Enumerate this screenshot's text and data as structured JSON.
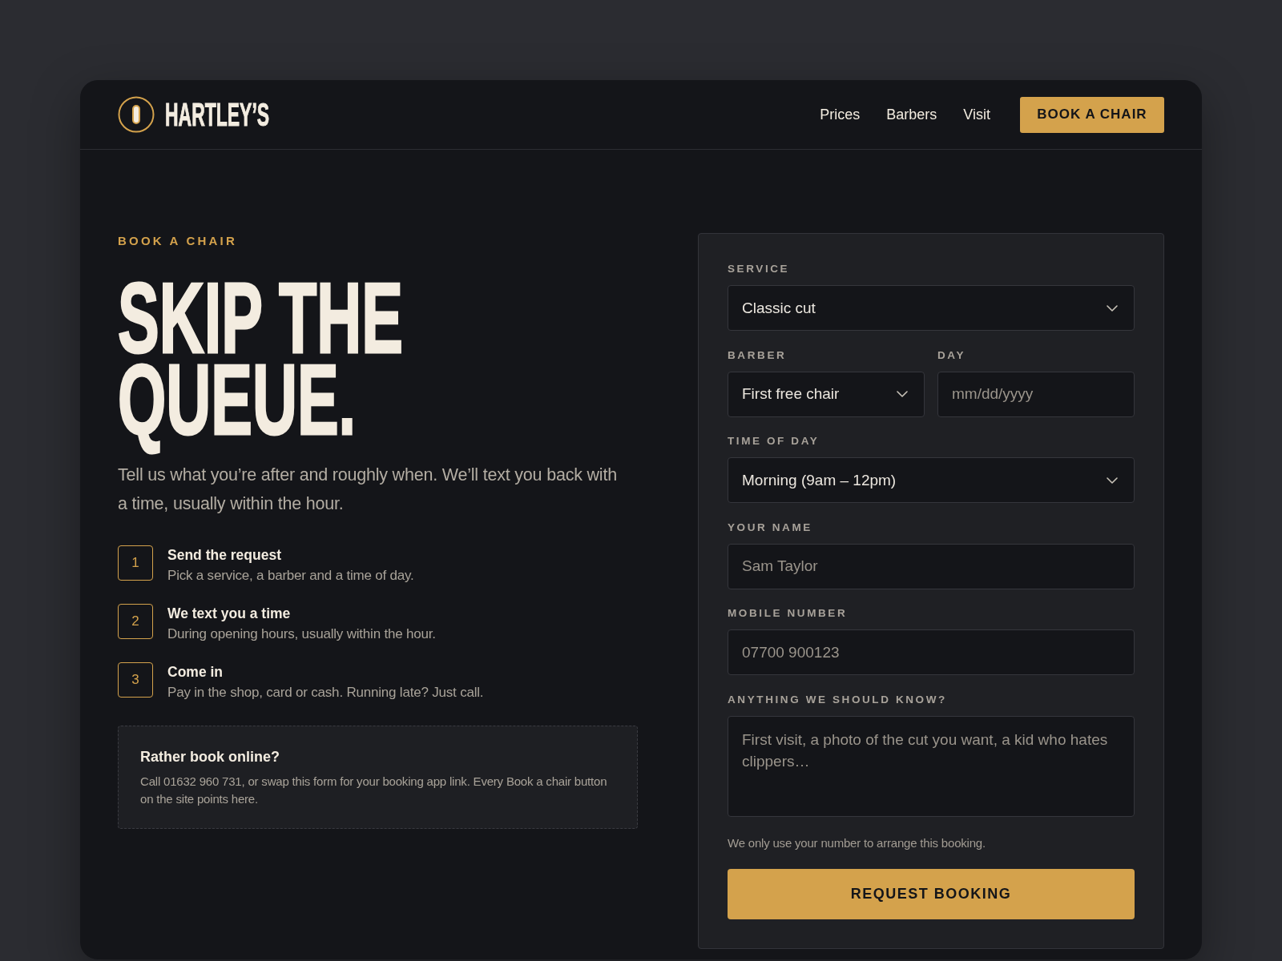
{
  "header": {
    "brand": "HARTLEY’S",
    "nav": [
      "Prices",
      "Barbers",
      "Visit"
    ],
    "cta": "BOOK A CHAIR"
  },
  "intro": {
    "eyebrow": "BOOK A CHAIR",
    "title": "SKIP THE QUEUE.",
    "lead": "Tell us what you’re after and roughly when. We’ll text you back with a time, usually within the hour."
  },
  "steps": [
    {
      "number": "1",
      "title": "Send the request",
      "text": "Pick a service, a barber and a time of day."
    },
    {
      "number": "2",
      "title": "We text you a time",
      "text": "During opening hours, usually within the hour."
    },
    {
      "number": "3",
      "title": "Come in",
      "text": "Pay in the shop, card or cash. Running late? Just call."
    }
  ],
  "callout": {
    "title": "Rather book online?",
    "text": "Call 01632 960 731, or swap this form for your booking app link. Every Book a chair button on the site points here."
  },
  "form": {
    "rows": [
      [
        {
          "kind": "select",
          "label": "SERVICE",
          "value": "Classic cut"
        }
      ],
      [
        {
          "kind": "select",
          "label": "BARBER",
          "value": "First free chair"
        },
        {
          "kind": "date",
          "label": "DAY",
          "placeholder": "mm/dd/yyyy"
        }
      ],
      [
        {
          "kind": "select",
          "label": "TIME OF DAY",
          "value": "Morning (9am – 12pm)"
        }
      ],
      [
        {
          "kind": "text",
          "label": "YOUR NAME",
          "placeholder": "Sam Taylor"
        }
      ],
      [
        {
          "kind": "text",
          "label": "MOBILE NUMBER",
          "placeholder": "07700 900123"
        }
      ],
      [
        {
          "kind": "textarea",
          "label": "ANYTHING WE SHOULD KNOW?",
          "placeholder": "First visit, a photo of the cut you want, a kid who hates clippers…"
        }
      ]
    ],
    "note": "We only use your number to arrange this booking.",
    "submit": "REQUEST BOOKING"
  }
}
